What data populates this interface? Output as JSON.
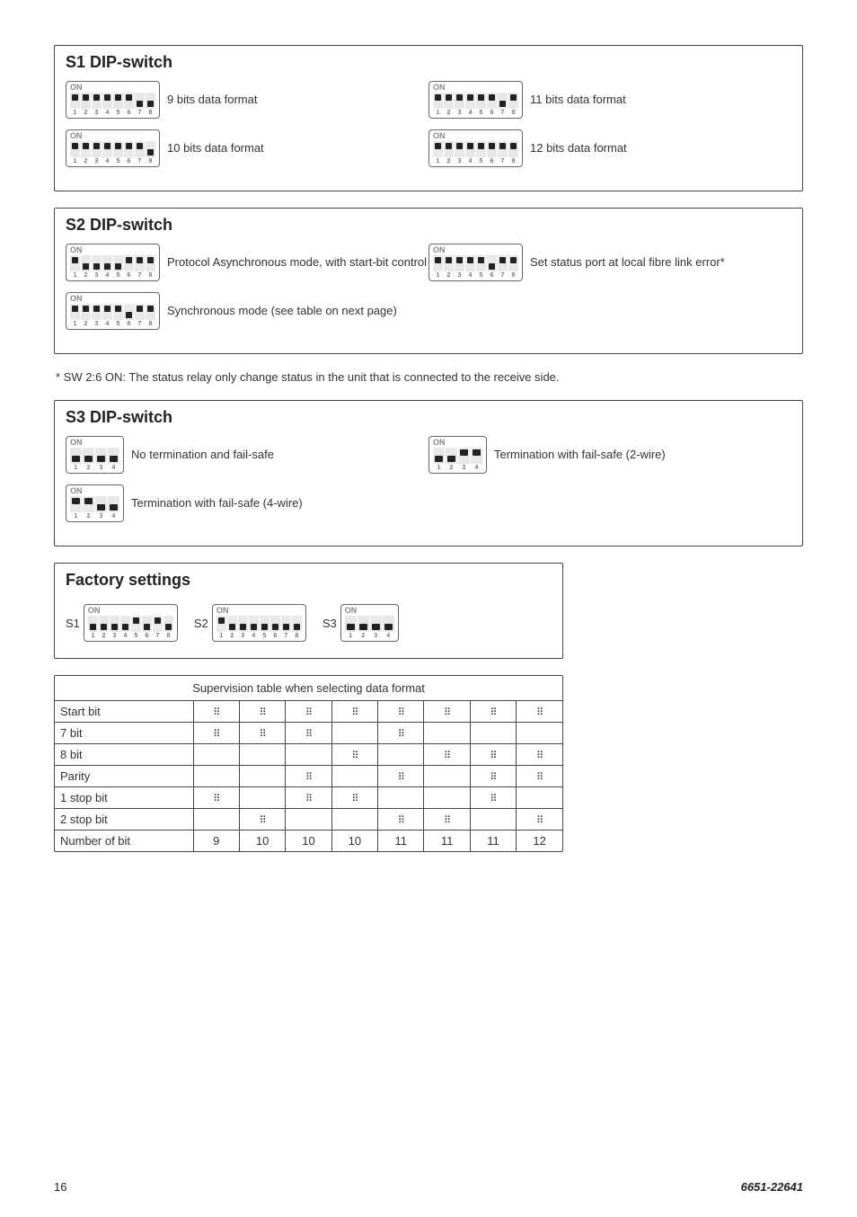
{
  "s1": {
    "title": "S1 DIP-switch",
    "items": [
      {
        "label": "9 bits data format",
        "sw": [
          0,
          0,
          0,
          0,
          0,
          0,
          1,
          1
        ]
      },
      {
        "label": "11 bits data format",
        "sw": [
          0,
          0,
          0,
          0,
          0,
          0,
          1,
          0
        ]
      },
      {
        "label": "10 bits data format",
        "sw": [
          0,
          0,
          0,
          0,
          0,
          0,
          0,
          1
        ]
      },
      {
        "label": "12 bits data format",
        "sw": [
          0,
          0,
          0,
          0,
          0,
          0,
          0,
          0
        ]
      }
    ]
  },
  "s2": {
    "title": "S2 DIP-switch",
    "items": [
      {
        "label": "Protocol Asynchronous mode, with start-bit control",
        "sw": [
          0,
          1,
          1,
          1,
          1,
          0,
          0,
          0
        ]
      },
      {
        "label": "Set status port at local fibre link error*",
        "sw": [
          0,
          0,
          0,
          0,
          0,
          1,
          0,
          0
        ]
      },
      {
        "label": "Synchronous mode (see table on next page)",
        "sw": [
          0,
          0,
          0,
          0,
          0,
          1,
          0,
          0
        ]
      }
    ]
  },
  "footnote": "* SW 2:6 ON: The status relay only change status in the unit that is connected to the receive side.",
  "s3": {
    "title": "S3 DIP-switch",
    "items": [
      {
        "label": "No termination and fail-safe",
        "sw": [
          1,
          1,
          1,
          1
        ]
      },
      {
        "label": "Termination with fail-safe (2-wire)",
        "sw": [
          1,
          1,
          0,
          0
        ]
      },
      {
        "label": "Termination with fail-safe (4-wire)",
        "sw": [
          0,
          0,
          1,
          1
        ]
      }
    ]
  },
  "factory": {
    "title": "Factory settings",
    "s1_label": "S1",
    "s2_label": "S2",
    "s3_label": "S3",
    "s1_sw": [
      1,
      1,
      1,
      1,
      0,
      1,
      0,
      1
    ],
    "s2_sw": [
      0,
      1,
      1,
      1,
      1,
      1,
      1,
      1
    ],
    "s3_sw": [
      1,
      1,
      1,
      1
    ]
  },
  "sup": {
    "title": "Supervision table when selecting data format",
    "rows": [
      {
        "name": "Start bit",
        "cells": [
          "x",
          "x",
          "x",
          "x",
          "x",
          "x",
          "x",
          "x"
        ]
      },
      {
        "name": "7 bit",
        "cells": [
          "x",
          "x",
          "x",
          "",
          "x",
          "",
          "",
          ""
        ]
      },
      {
        "name": "8 bit",
        "cells": [
          "",
          "",
          "",
          "x",
          "",
          "x",
          "x",
          "x"
        ]
      },
      {
        "name": "Parity",
        "cells": [
          "",
          "",
          "x",
          "",
          "x",
          "",
          "x",
          "x"
        ]
      },
      {
        "name": "1 stop bit",
        "cells": [
          "x",
          "",
          "x",
          "x",
          "",
          "",
          "x",
          ""
        ]
      },
      {
        "name": "2 stop bit",
        "cells": [
          "",
          "x",
          "",
          "",
          "x",
          "x",
          "",
          "x"
        ]
      },
      {
        "name": "Number of bit",
        "cells": [
          "9",
          "10",
          "10",
          "10",
          "11",
          "11",
          "11",
          "12"
        ]
      }
    ]
  },
  "footer": {
    "page": "16",
    "doc": "6651-22641"
  }
}
